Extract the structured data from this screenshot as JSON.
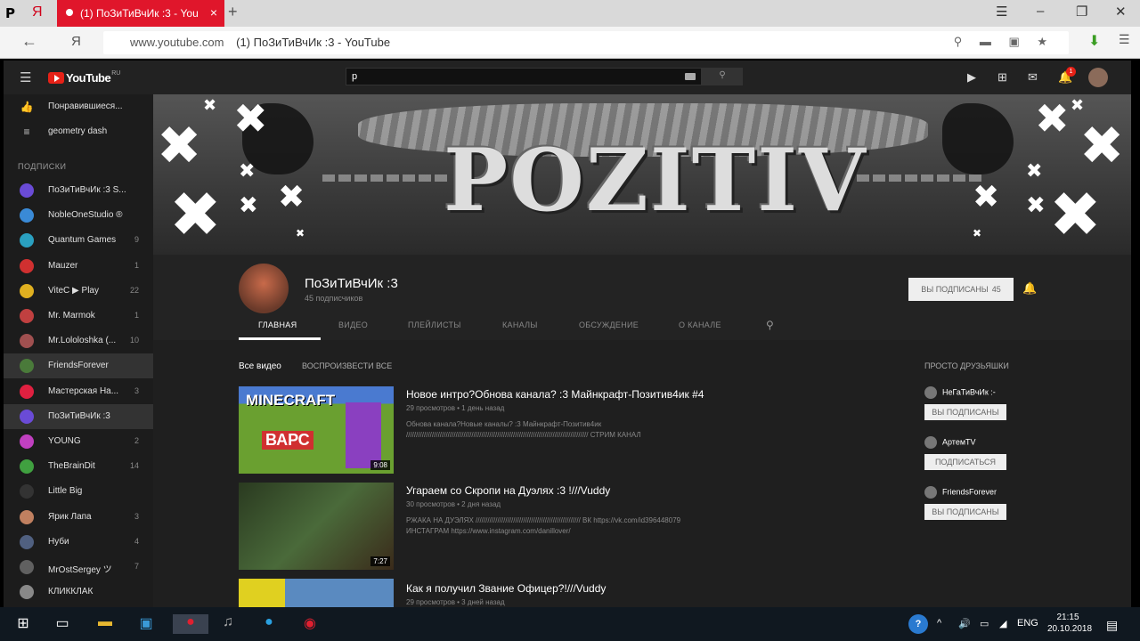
{
  "browser": {
    "logo_letter": "P",
    "yandex_letter": "Я",
    "tab_title": "(1) ПоЗиТиВчИк :3 - You",
    "tab_close": "×",
    "new_tab": "+",
    "win_min": "–",
    "win_max": "❐",
    "win_close": "✕",
    "back": "←",
    "nav_y": "Я",
    "url_host": "www.youtube.com",
    "url_title": "(1) ПоЗиТиВчИк :3 - YouTube",
    "url_icons": "⚲ ▬ ▣ ★"
  },
  "youtube": {
    "logo_text": "YouTube",
    "logo_sup": "RU",
    "search_value": "p",
    "notif_count": "1"
  },
  "sidebar": {
    "top_items": [
      {
        "label": "Понравившиеся...",
        "icon": "👍"
      },
      {
        "label": "geometry dash",
        "icon": "≡"
      }
    ],
    "subs_heading": "ПОДПИСКИ",
    "subs": [
      {
        "label": "ПоЗиТиВчИк :3 S...",
        "count": "",
        "color": "#6a4bd6"
      },
      {
        "label": "NobleOneStudio ®",
        "count": "",
        "color": "#3a8ad6"
      },
      {
        "label": "Quantum Games",
        "count": "9",
        "color": "#2aa0c0"
      },
      {
        "label": "Mauzer",
        "count": "1",
        "color": "#d03030"
      },
      {
        "label": "ViteC ▶ Play",
        "count": "22",
        "color": "#e0b020"
      },
      {
        "label": "Mr. Marmok",
        "count": "1",
        "color": "#c04040"
      },
      {
        "label": "Mr.Lololoshka (...",
        "count": "10",
        "color": "#a05050"
      },
      {
        "label": "FriendsForever",
        "count": "",
        "color": "#4a7a3a"
      },
      {
        "label": "Мастерская На...",
        "count": "3",
        "color": "#e02040"
      },
      {
        "label": "ПоЗиТиВчИк :3",
        "count": "",
        "color": "#6a4bd6"
      },
      {
        "label": "YOUNG",
        "count": "2",
        "color": "#c040c0"
      },
      {
        "label": "TheBrainDit",
        "count": "14",
        "color": "#40a040"
      },
      {
        "label": "Little Big",
        "count": "",
        "color": "#333333"
      },
      {
        "label": "Ярик Лапа",
        "count": "3",
        "color": "#c08060"
      },
      {
        "label": "Нуби",
        "count": "4",
        "color": "#506080"
      },
      {
        "label": "MrOstSergey ツ",
        "count": "7",
        "color": "#606060"
      },
      {
        "label": "КЛИККЛАК",
        "count": "",
        "color": "#888888"
      }
    ]
  },
  "banner": {
    "title": "POZITIV",
    "mark": "✖"
  },
  "channel": {
    "name": "ПоЗиТиВчИк :3",
    "subs": "45 подписчиков",
    "sub_button": "ВЫ ПОДПИСАНЫ",
    "sub_count": "45",
    "tabs": [
      "ГЛАВНАЯ",
      "ВИДЕО",
      "ПЛЕЙЛИСТЫ",
      "КАНАЛЫ",
      "ОБСУЖДЕНИЕ",
      "О КАНАЛЕ"
    ]
  },
  "content": {
    "section_all": "Все видео",
    "section_play": "ВОСПРОИЗВЕСТИ ВСЕ",
    "videos": [
      {
        "title": "Новое интро?Обнова канала? :3 Майнкрафт-Позитив4ик #4",
        "meta": "29 просмотров • 1 день назад",
        "desc1": "Обнова канала?Новые каналы? :3 Майнкрафт-Позитив4ик",
        "desc2": "//////////////////////////////////////////////////////////////////////////////////////////// СТРИМ КАНАЛ",
        "duration": "9:08",
        "thumb_text": "MINECRAFT",
        "thumb_sub": "ВАРС"
      },
      {
        "title": "Угараем со Скропи на Дуэлях :3 !///Vuddy",
        "meta": "30 просмотров • 2 дня назад",
        "desc1": "РЖАКА НА ДУЭЛЯХ ///////////////////////////////////////////////////// ВК https://vk.com/id396448079",
        "desc2": "ИНСТАГРАМ https://www.instagram.com/danillover/",
        "duration": "7:27"
      },
      {
        "title": "Как я получил Звание Офицер?!///Vuddy",
        "meta": "29 просмотров • 3 дней назад",
        "duration": ""
      }
    ],
    "related_heading": "ПРОСТО ДРУЗЬЯШКИ",
    "related": [
      {
        "name": "НеГаТиВчИк :-",
        "button": "ВЫ ПОДПИСАНЫ"
      },
      {
        "name": "АртемTV",
        "button": "ПОДПИСАТЬСЯ"
      },
      {
        "name": "FriendsForever",
        "button": "ВЫ ПОДПИСАНЫ"
      }
    ]
  },
  "taskbar": {
    "start": "⊞",
    "lang": "ENG",
    "time": "21:15",
    "date": "20.10.2018",
    "help": "?"
  }
}
